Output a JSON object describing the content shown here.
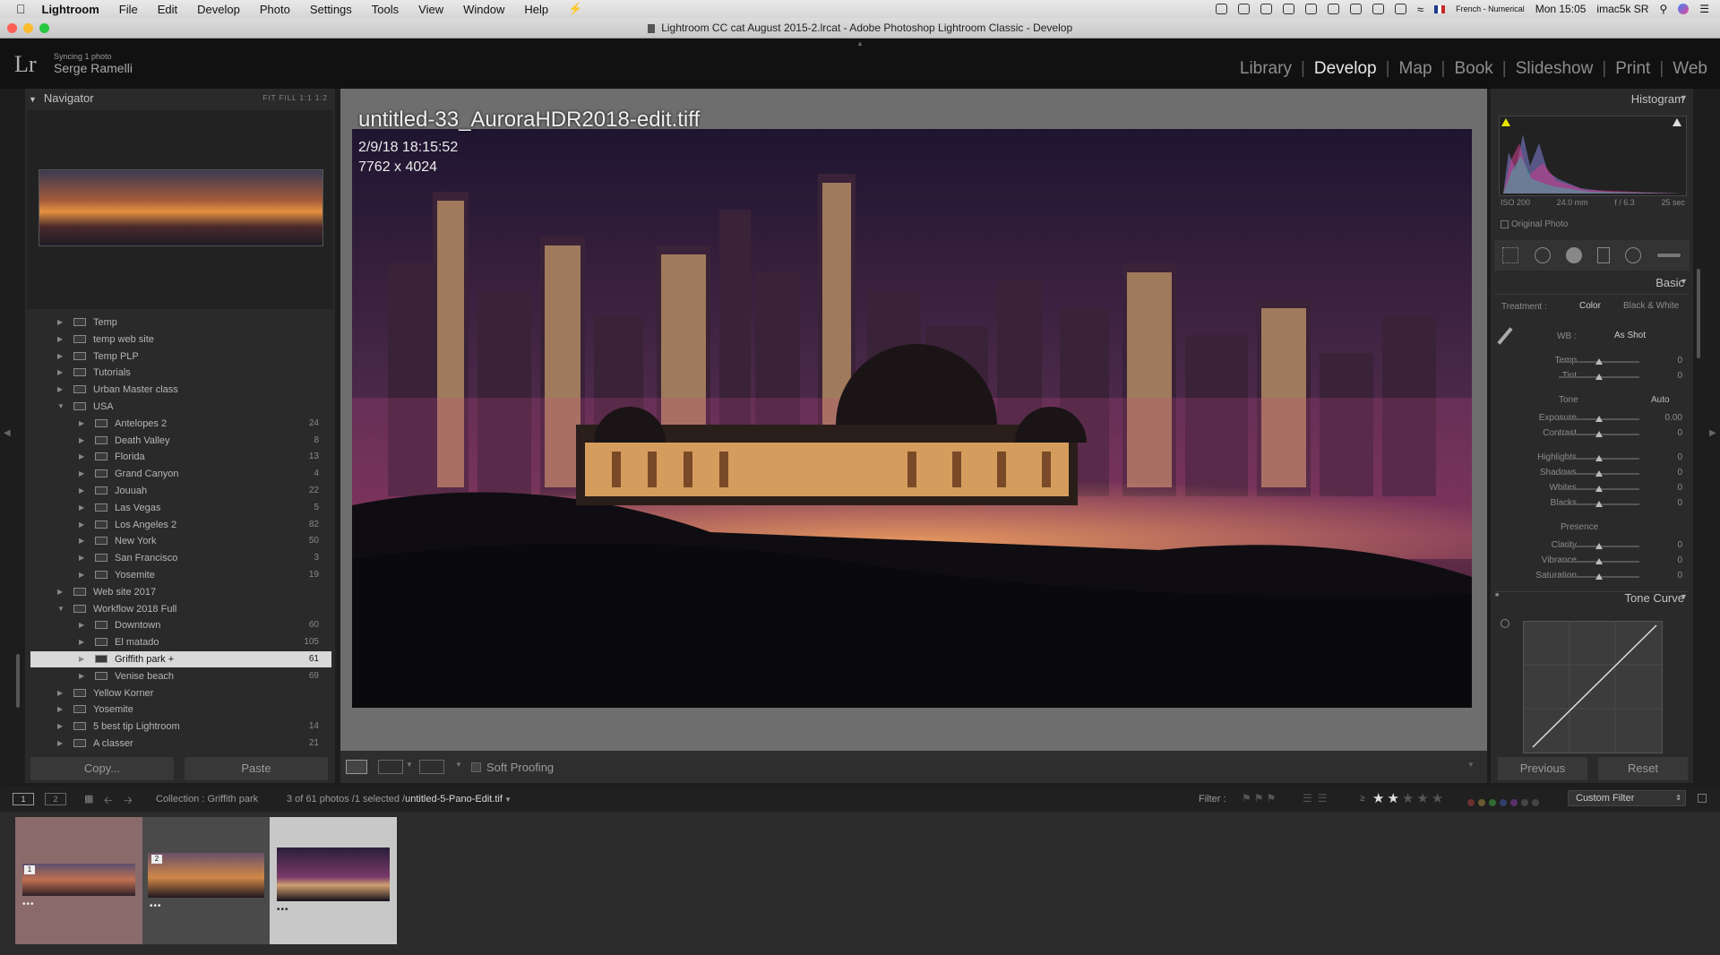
{
  "menubar": {
    "app": "Lightroom",
    "items": [
      "File",
      "Edit",
      "Develop",
      "Photo",
      "Settings",
      "Tools",
      "View",
      "Window",
      "Help"
    ],
    "input_source": "French - Numerical",
    "clock": "Mon 15:05",
    "user": "imac5k SR"
  },
  "window": {
    "title": "Lightroom CC cat August 2015-2.lrcat - Adobe Photoshop Lightroom Classic - Develop"
  },
  "identity": {
    "logo": "Lr",
    "syncing": "Syncing 1 photo",
    "user": "Serge Ramelli"
  },
  "modules": [
    "Library",
    "Develop",
    "Map",
    "Book",
    "Slideshow",
    "Print",
    "Web"
  ],
  "active_module": "Develop",
  "navigator": {
    "title": "Navigator",
    "zoom_options": "FIT  FILL  1:1  1:2"
  },
  "folders": [
    {
      "name": "Temp",
      "count": "",
      "level": 0,
      "expanded": false
    },
    {
      "name": "temp web site",
      "count": "",
      "level": 0,
      "expanded": false
    },
    {
      "name": "Temp PLP",
      "count": "",
      "level": 0,
      "expanded": false
    },
    {
      "name": "Tutorials",
      "count": "",
      "level": 0,
      "expanded": false
    },
    {
      "name": "Urban Master class",
      "count": "",
      "level": 0,
      "expanded": false
    },
    {
      "name": "USA",
      "count": "",
      "level": 0,
      "expanded": true
    },
    {
      "name": "Antelopes 2",
      "count": "24",
      "level": 1,
      "expanded": false
    },
    {
      "name": "Death Valley",
      "count": "8",
      "level": 1,
      "expanded": false
    },
    {
      "name": "Florida",
      "count": "13",
      "level": 1,
      "expanded": false
    },
    {
      "name": "Grand Canyon",
      "count": "4",
      "level": 1,
      "expanded": false
    },
    {
      "name": "Jouuah",
      "count": "22",
      "level": 1,
      "expanded": false
    },
    {
      "name": "Las Vegas",
      "count": "5",
      "level": 1,
      "expanded": false
    },
    {
      "name": "Los Angeles 2",
      "count": "82",
      "level": 1,
      "expanded": false
    },
    {
      "name": "New York",
      "count": "50",
      "level": 1,
      "expanded": false
    },
    {
      "name": "San Francisco",
      "count": "3",
      "level": 1,
      "expanded": false
    },
    {
      "name": "Yosemite",
      "count": "19",
      "level": 1,
      "expanded": false
    },
    {
      "name": "Web site 2017",
      "count": "",
      "level": 0,
      "expanded": false
    },
    {
      "name": "Workflow 2018 Full",
      "count": "",
      "level": 0,
      "expanded": true
    },
    {
      "name": "Downtown",
      "count": "60",
      "level": 1,
      "expanded": false
    },
    {
      "name": "El matado",
      "count": "105",
      "level": 1,
      "expanded": false
    },
    {
      "name": "Griffith park +",
      "count": "61",
      "level": 1,
      "expanded": false,
      "selected": true
    },
    {
      "name": "Venise beach",
      "count": "69",
      "level": 1,
      "expanded": false
    },
    {
      "name": "Yellow Korner",
      "count": "",
      "level": 0,
      "expanded": false
    },
    {
      "name": "Yosemite",
      "count": "",
      "level": 0,
      "expanded": false
    },
    {
      "name": "5 best tip Lightroom",
      "count": "14",
      "level": 0,
      "expanded": false
    },
    {
      "name": "A classer",
      "count": "21",
      "level": 0,
      "expanded": false
    }
  ],
  "left_buttons": {
    "copy": "Copy...",
    "paste": "Paste"
  },
  "photo": {
    "filename": "untitled-33_AuroraHDR2018-edit.tiff",
    "date": "2/9/18 18:15:52",
    "dimensions": "7762 x 4024"
  },
  "toolbar": {
    "soft_proofing": "Soft Proofing"
  },
  "histogram": {
    "title": "Histogram",
    "iso": "ISO 200",
    "focal": "24.0 mm",
    "aperture": "f / 6.3",
    "shutter": "25 sec",
    "original_photo": "Original Photo"
  },
  "basic": {
    "title": "Basic",
    "treatment_label": "Treatment :",
    "color": "Color",
    "bw": "Black & White",
    "wb_label": "WB :",
    "wb_value": "As Shot",
    "temp": {
      "label": "Temp",
      "value": "0"
    },
    "tint": {
      "label": "Tint",
      "value": "0"
    },
    "tone_label": "Tone",
    "auto": "Auto",
    "exposure": {
      "label": "Exposure",
      "value": "0.00"
    },
    "contrast": {
      "label": "Contrast",
      "value": "0"
    },
    "highlights": {
      "label": "Highlights",
      "value": "0"
    },
    "shadows": {
      "label": "Shadows",
      "value": "0"
    },
    "whites": {
      "label": "Whites",
      "value": "0"
    },
    "blacks": {
      "label": "Blacks",
      "value": "0"
    },
    "presence_label": "Presence",
    "clarity": {
      "label": "Clarity",
      "value": "0"
    },
    "vibrance": {
      "label": "Vibrance",
      "value": "0"
    },
    "saturation": {
      "label": "Saturation",
      "value": "0"
    }
  },
  "tone_curve": {
    "title": "Tone Curve"
  },
  "right_buttons": {
    "previous": "Previous",
    "reset": "Reset"
  },
  "filmstrip": {
    "screen1": "1",
    "screen2": "2",
    "collection": "Collection : Griffith park",
    "count": "3 of 61 photos /1 selected /",
    "selected_file": "untitled-5-Pano-Edit.tif",
    "filter_label": "Filter :",
    "rating_stars": 2,
    "rating_max": 5,
    "custom_filter": "Custom Filter",
    "thumbs": [
      {
        "badge": "1"
      },
      {
        "badge": "2"
      },
      {
        "badge": ""
      }
    ]
  }
}
